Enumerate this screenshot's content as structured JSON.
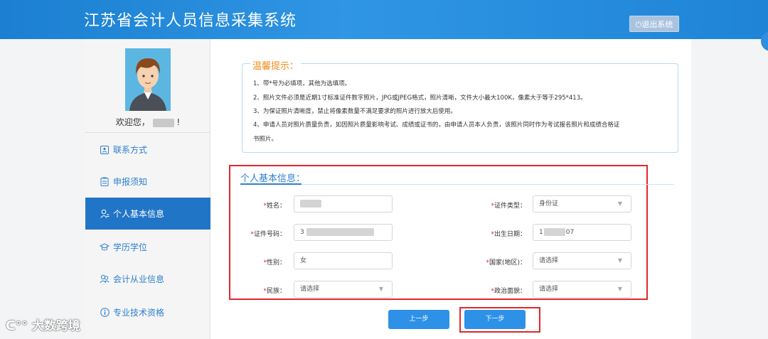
{
  "header": {
    "app_title": "江苏省会计人员信息采集系统",
    "logout_label": "⏻退出系统"
  },
  "sidebar": {
    "welcome_prefix": "欢迎您，",
    "welcome_suffix": "!",
    "items": [
      {
        "label": "联系方式",
        "icon": "contact-icon"
      },
      {
        "label": "申报须知",
        "icon": "notice-icon"
      },
      {
        "label": "个人基本信息",
        "icon": "person-icon",
        "active": true
      },
      {
        "label": "学历学位",
        "icon": "graduation-cap-icon"
      },
      {
        "label": "会计从业信息",
        "icon": "group-icon"
      },
      {
        "label": "专业技术资格",
        "icon": "info-icon"
      }
    ]
  },
  "tips": {
    "title": "温馨提示：",
    "lines": [
      "1、带*号为必填项，其他为选填项。",
      "2、照片文件必须是近期1寸标准证件数字照片，JPG或JPEG格式，照片清晰，文件大小最大100K，像素大于等于295*413。",
      "3、为保证照片清晰度，禁止将像素数量不满足要求的照片进行放大后使用。",
      "4、申请人员对照片质量负责，如因照片质量影响考试、成绩或证书的，由申请人员本人负责，该照片同时作为考试报名照片和成绩合格证",
      "书照片。"
    ]
  },
  "form": {
    "section_title": "个人基本信息：",
    "fields": {
      "name": {
        "label": "姓名：",
        "value": ""
      },
      "id_type": {
        "label": "证件类型：",
        "value": "身份证"
      },
      "id_number": {
        "label": "证件号码：",
        "value_prefix": "3"
      },
      "birth_date": {
        "label": "出生日期：",
        "value_prefix": "1",
        "value_suffix": "07"
      },
      "gender": {
        "label": "性别：",
        "value": "女"
      },
      "country": {
        "label": "国家(地区)：",
        "value": "请选择"
      },
      "ethnicity": {
        "label": "民族：",
        "value": "请选择"
      },
      "political_status": {
        "label": "政治面貌：",
        "value": "请选择"
      }
    },
    "prev_label": "上一步",
    "next_label": "下一步"
  },
  "watermark": "大数跨境"
}
